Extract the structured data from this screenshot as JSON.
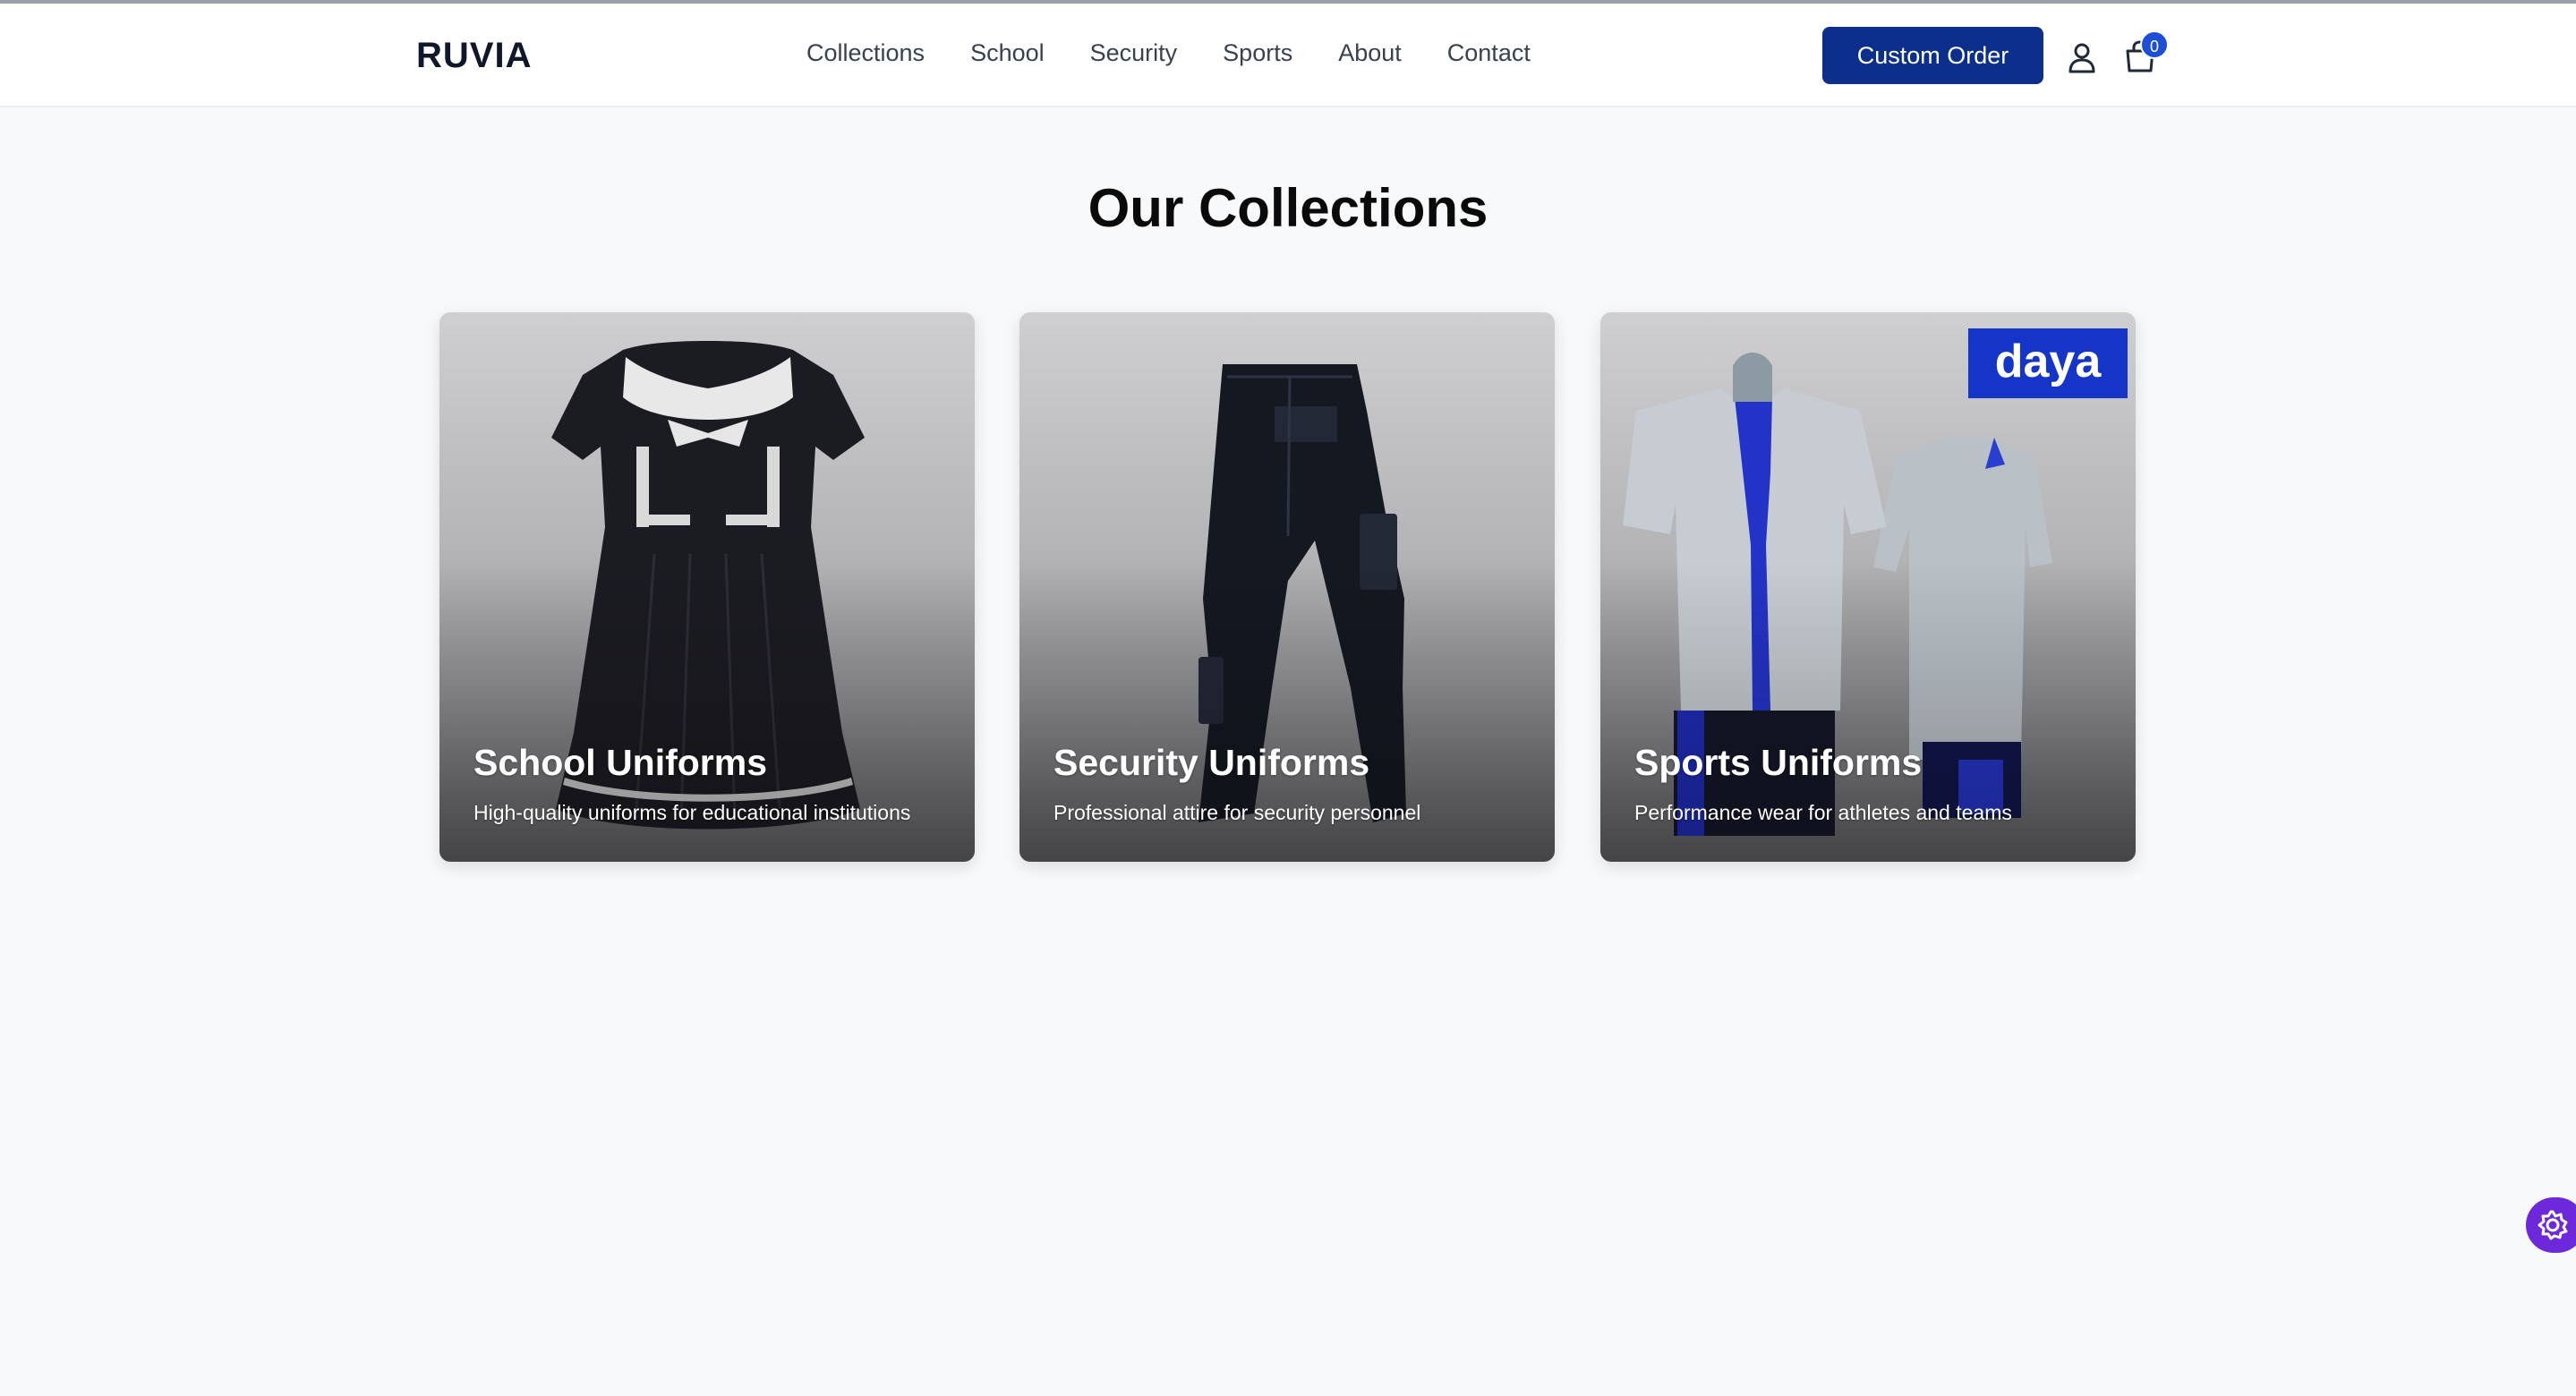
{
  "header": {
    "logo": "RUVIA",
    "nav": [
      "Collections",
      "School",
      "Security",
      "Sports",
      "About",
      "Contact"
    ],
    "cta_label": "Custom Order",
    "cart_count": "0",
    "icons": {
      "user": "user-icon",
      "cart": "shopping-bag-icon"
    }
  },
  "main": {
    "title": "Our Collections",
    "collections": [
      {
        "title": "School Uniforms",
        "description": "High-quality uniforms for educational institutions"
      },
      {
        "title": "Security Uniforms",
        "description": "Professional attire for security personnel"
      },
      {
        "title": "Sports Uniforms",
        "description": "Performance wear for athletes and teams",
        "brand_badge": "daya"
      }
    ]
  },
  "floating_button": {
    "icon": "gear-icon"
  },
  "colors": {
    "primary": "#0b2f8a",
    "badge": "#1d4ed8",
    "floating": "#6d28d9",
    "background": "#f8f9fb"
  }
}
